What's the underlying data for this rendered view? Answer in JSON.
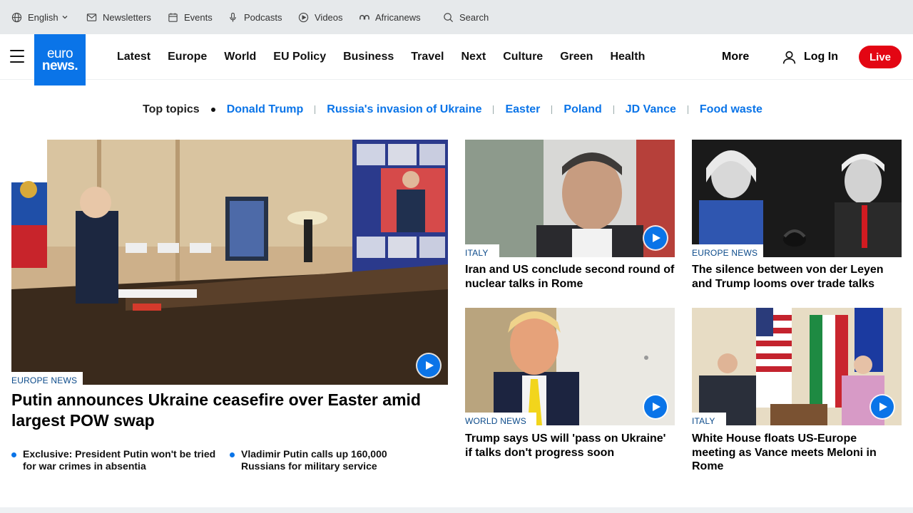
{
  "utility_bar": {
    "language": "English",
    "items": [
      {
        "label": "Newsletters",
        "icon": "mail-icon"
      },
      {
        "label": "Events",
        "icon": "calendar-icon"
      },
      {
        "label": "Podcasts",
        "icon": "microphone-icon"
      },
      {
        "label": "Videos",
        "icon": "play-circle-icon"
      },
      {
        "label": "Africanews",
        "icon": "africanews-icon"
      }
    ],
    "search_label": "Search"
  },
  "logo": {
    "line1": "euro",
    "line2": "news."
  },
  "nav": {
    "links": [
      "Latest",
      "Europe",
      "World",
      "EU Policy",
      "Business",
      "Travel",
      "Next",
      "Culture",
      "Green",
      "Health"
    ],
    "more_label": "More",
    "login_label": "Log In",
    "live_label": "Live"
  },
  "top_topics": {
    "title": "Top topics",
    "items": [
      "Donald Trump",
      "Russia's invasion of Ukraine",
      "Easter",
      "Poland",
      "JD Vance",
      "Food waste"
    ]
  },
  "hero": {
    "category": "EUROPE NEWS",
    "title": "Putin announces Ukraine ceasefire over Easter amid largest POW swap",
    "has_video": true,
    "related": [
      "Exclusive: President Putin won't be tried for war crimes in absentia",
      "Vladimir Putin calls up 160,000 Russians for military service"
    ]
  },
  "cards": [
    {
      "category": "ITALY",
      "title": "Iran and US conclude second round of nuclear talks in Rome",
      "has_video": true
    },
    {
      "category": "EUROPE NEWS",
      "title": "The silence between von der Leyen and Trump looms over trade talks",
      "has_video": false
    },
    {
      "category": "WORLD NEWS",
      "title": "Trump says US will 'pass on Ukraine' if talks don't progress soon",
      "has_video": true
    },
    {
      "category": "ITALY",
      "title": "White House floats US-Europe meeting as Vance meets Meloni in Rome",
      "has_video": true
    }
  ],
  "colors": {
    "brand_blue": "#0a74e8",
    "live_red": "#e30613",
    "utility_bg": "#e6e9eb",
    "category_text": "#0b4a8a"
  }
}
